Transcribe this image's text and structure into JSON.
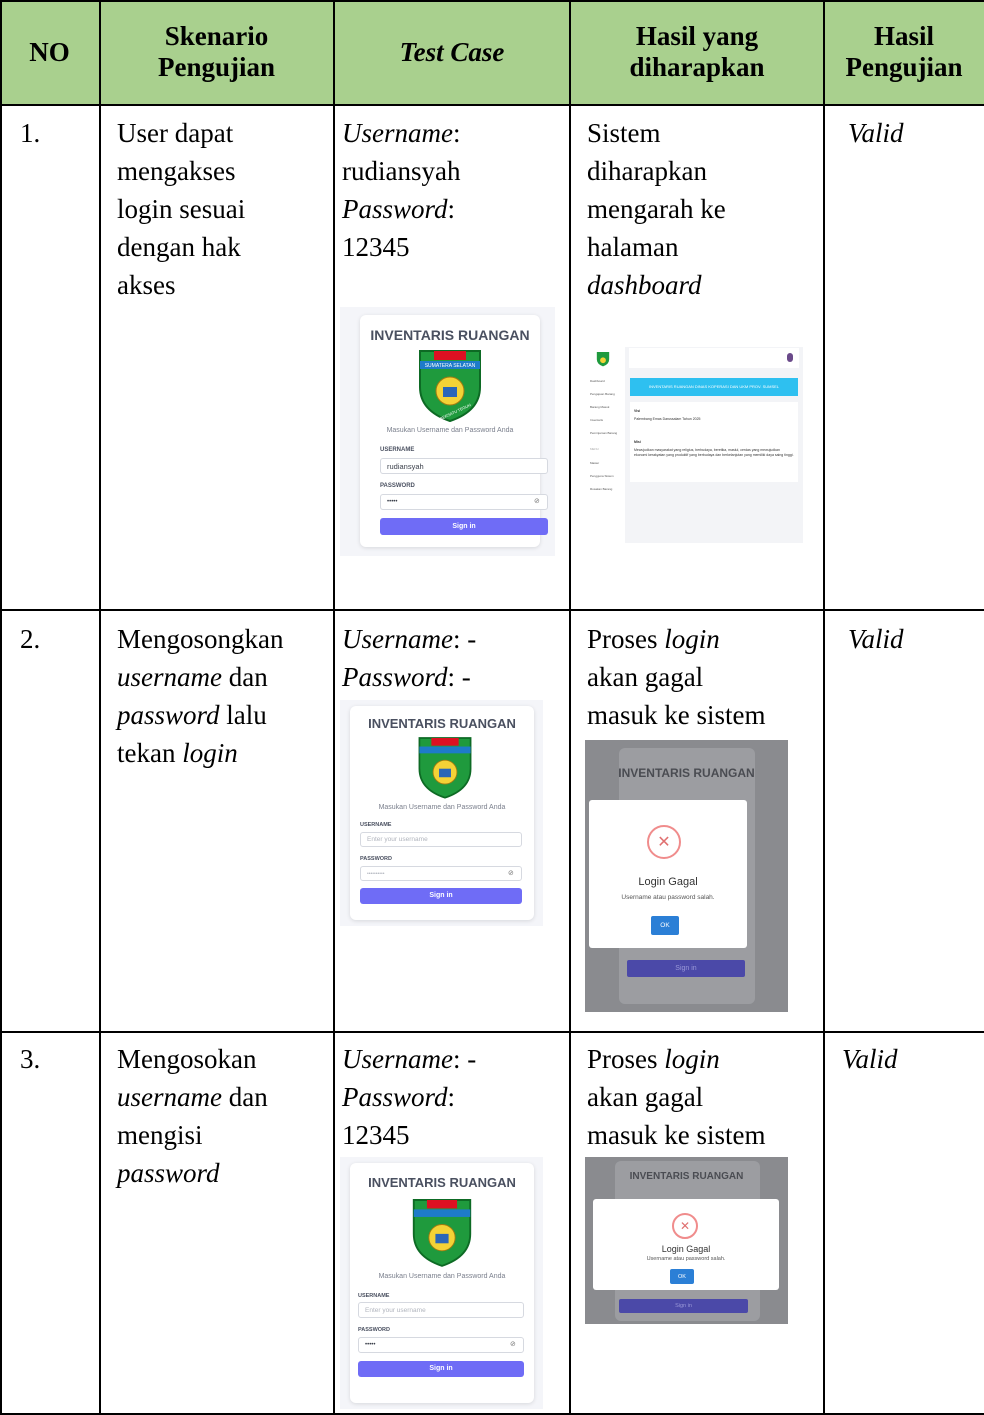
{
  "header": {
    "no": "NO",
    "skenario_1": "Skenario",
    "skenario_2": "Pengujian",
    "test_case": "Test Case",
    "hasil_diharapkan_1": "Hasil yang",
    "hasil_diharapkan_2": "diharapkan",
    "hasil_pengujian_1": "Hasil",
    "hasil_pengujian_2": "Pengujian"
  },
  "rows": [
    {
      "no": "1.",
      "skenario": [
        "User dapat",
        "mengakses",
        "login sesuai",
        "dengan hak",
        "akses"
      ],
      "test_case": {
        "user_label": "Username",
        "user_value": "rudiansyah",
        "pass_label": "Password",
        "pass_value": "12345"
      },
      "expected": [
        "Sistem",
        "diharapkan",
        "mengarah ke",
        "halaman",
        "dashboard"
      ],
      "result": "Valid"
    },
    {
      "no": "2.",
      "skenario": [
        "Mengosongkan",
        "username",
        "dan",
        "password",
        "lalu",
        "tekan",
        "login"
      ],
      "test_case": {
        "user_label": "Username",
        "user_value": "-",
        "pass_label": "Password",
        "pass_value": "-"
      },
      "expected": [
        "Proses",
        "login",
        "akan gagal",
        "masuk ke sistem"
      ],
      "result": "Valid"
    },
    {
      "no": "3.",
      "skenario": [
        "Mengosokan",
        "username",
        "dan",
        "mengisi",
        "password"
      ],
      "test_case": {
        "user_label": "Username",
        "user_value": "-",
        "pass_label": "Password",
        "pass_value": "12345"
      },
      "expected": [
        "Proses",
        "login",
        "akan gagal",
        "masuk ke sistem"
      ],
      "result": "Valid"
    }
  ],
  "login_card": {
    "title": "INVENTARIS RUANGAN",
    "logo_text": "SUMATERA SELATAN",
    "logo_sub": "BERSATU TEGUH",
    "subtitle": "Masukan Username dan Password Anda",
    "username_label": "USERNAME",
    "password_label": "PASSWORD",
    "username_placeholder": "Enter your username",
    "filled_username": "rudiansyah",
    "masked_password": "•••••",
    "empty_password": "••••••••••",
    "signin": "Sign in"
  },
  "dashboard": {
    "banner": "INVENTARIS RUANGAN DINAS KOPERASI DAN UKM PROV. SUMSEL",
    "menu": [
      "Dashboard",
      "Pengajuan Barang",
      "Barang Masuk",
      "Inventaris",
      "Peminjaman Barang",
      "MENU",
      "Master",
      "Pengguna Sistem",
      "Rusakan Barang"
    ],
    "visi_label": "Visi",
    "visi_text": "Palembang Emas Darussalam Tahun 2025",
    "misi_label": "Misi",
    "misi_text": "Mewujudkan masyarakat yang religius, berbudaya, beretika, maslul, cerdas yang mewujudkan ekonomi kerakyatan yang produktif yang berbudaya dan berkelanjutan yang memiliki daya saing tinggi."
  },
  "modal": {
    "title": "Login Gagal",
    "message": "Username atau password salah.",
    "ok": "OK",
    "close_glyph": "✕",
    "bg_title": "INVENTARIS RUANGAN",
    "bg_signin": "Sign in"
  },
  "colors": {
    "header_bg": "#a9d08e",
    "signin_button": "#6f6cf6",
    "banner": "#2ec0f0",
    "ok_button": "#2b7fd6"
  }
}
